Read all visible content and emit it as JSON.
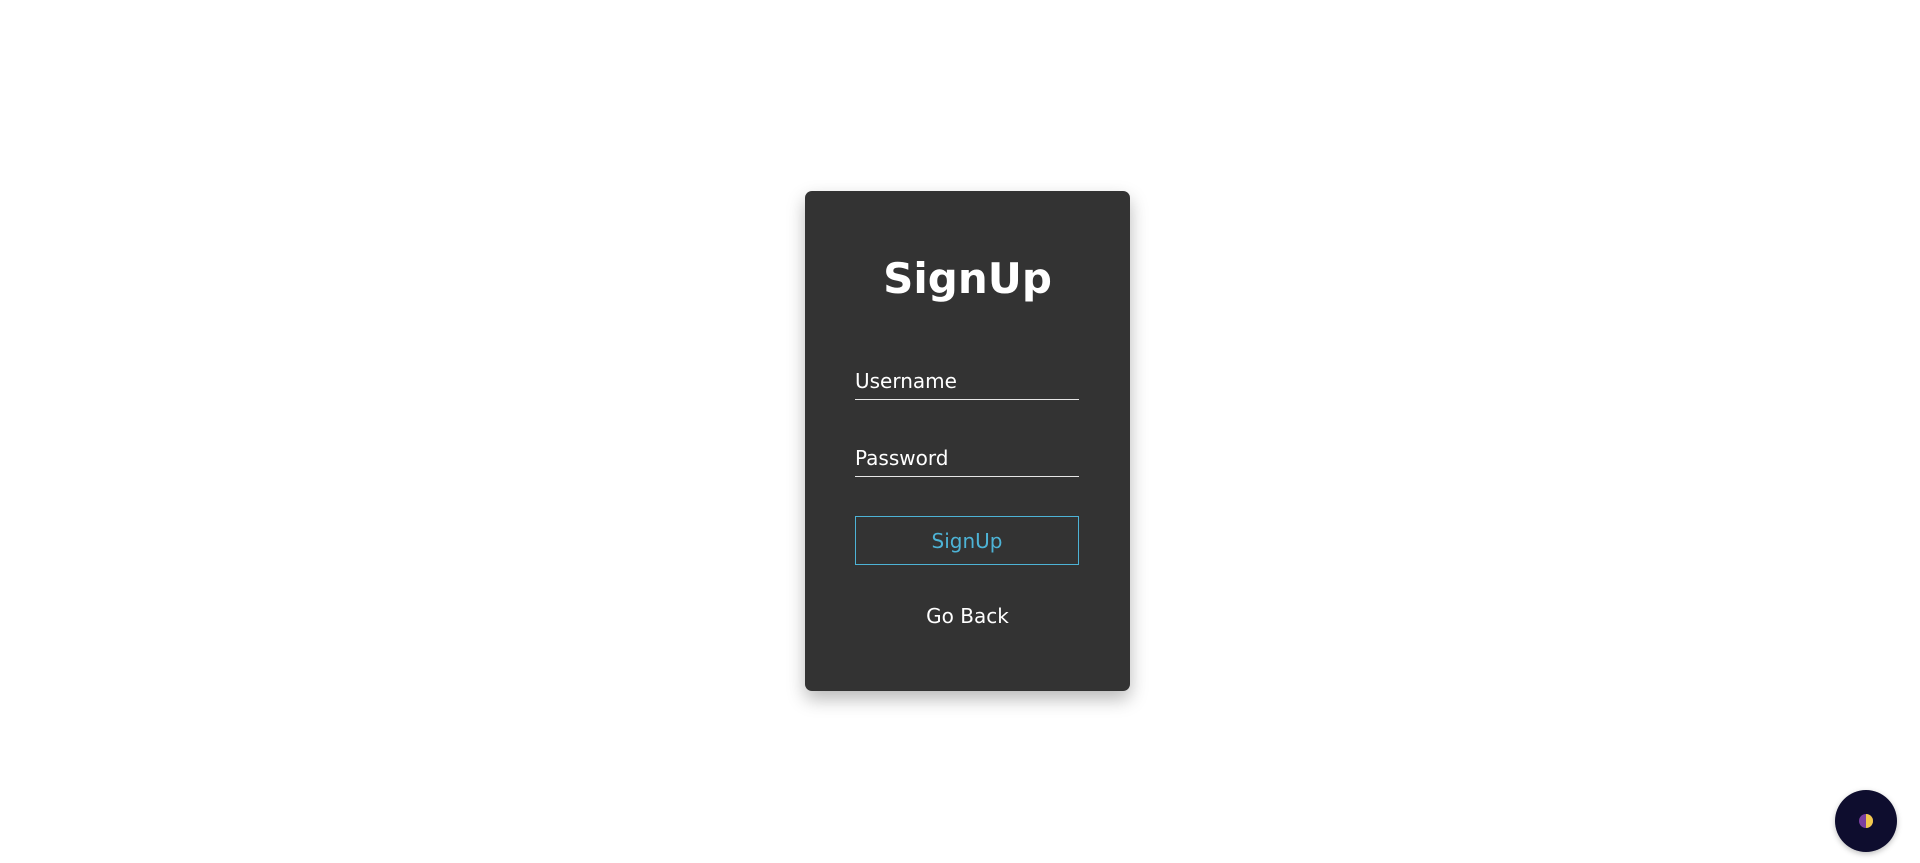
{
  "signup_card": {
    "title": "SignUp",
    "username_placeholder": "Username",
    "password_placeholder": "Password",
    "submit_label": "SignUp",
    "back_label": "Go Back"
  },
  "theme_toggle": {
    "icon": "half-moon-icon"
  },
  "colors": {
    "page_background": "#ffffff",
    "card_background": "#333333",
    "accent": "#4db3d6",
    "text": "#ffffff",
    "toggle_background": "#0e0d2e",
    "icon_purple": "#7b3fa0",
    "icon_yellow": "#f2c94c"
  }
}
